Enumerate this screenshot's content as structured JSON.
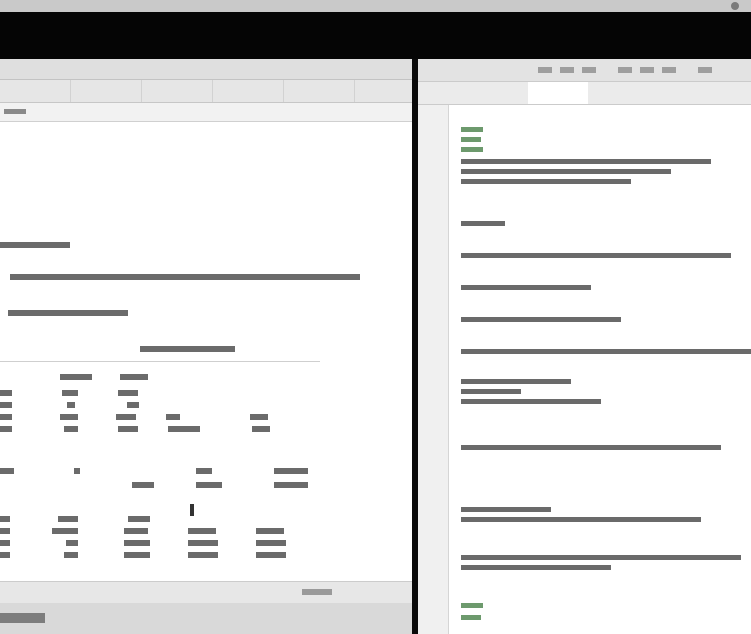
{
  "window": {
    "title": ""
  },
  "left_panel": {
    "tabs": [
      {
        "label": ""
      },
      {
        "label": ""
      },
      {
        "label": ""
      },
      {
        "label": ""
      },
      {
        "label": ""
      }
    ],
    "results_note": ""
  },
  "right_panel": {
    "tabs": [
      {
        "label": ""
      },
      {
        "label": ""
      },
      {
        "label": ""
      },
      {
        "label": ""
      }
    ]
  },
  "colors": {
    "titlebar": "#c9c9c9",
    "toolbar_dark": "#050505",
    "divider": "#0a0a0a",
    "highlight_line": "#dfe7f7",
    "comment_green": "#6d9a6d"
  }
}
